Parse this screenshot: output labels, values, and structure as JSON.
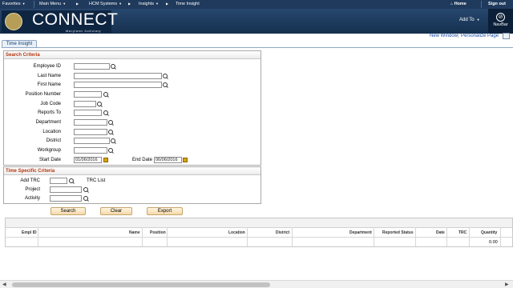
{
  "topbar": {
    "favorites": "Favorites",
    "main_menu": "Main Menu",
    "breadcrumb": [
      "HCM Systems",
      "Insights",
      "Time Insight"
    ],
    "home": "Home",
    "sign_out": "Sign out"
  },
  "header": {
    "brand": "CONNECT",
    "brand_sub": "Maryland Judiciary",
    "add_to": "Add To",
    "navbar": "NavBar"
  },
  "links": {
    "new_window": "New Window",
    "personalize": "Personalize Page"
  },
  "tab": "Time Insight",
  "search": {
    "title": "Search Criteria",
    "fields": {
      "employee_id": "Employee ID",
      "last_name": "Last Name",
      "first_name": "First Name",
      "position_number": "Position Number",
      "job_code": "Job Code",
      "reports_to": "Reports To",
      "department": "Department",
      "location": "Location",
      "district": "District",
      "workgroup": "Workgroup",
      "start_date": "Start Date",
      "end_date": "End Date"
    },
    "values": {
      "start_date": "01/06/2016",
      "end_date": "06/06/2016"
    }
  },
  "time_specific": {
    "title": "Time Specific Criteria",
    "add_trc": "Add TRC",
    "trc_list": "TRC List",
    "project": "Project",
    "activity": "Activity"
  },
  "buttons": {
    "search": "Search",
    "clear": "Clear",
    "export": "Export"
  },
  "grid": {
    "columns": [
      "Empl ID",
      "Name",
      "Position",
      "Location",
      "District",
      "Department",
      "Reported Status",
      "Date",
      "TRC",
      "Quantity"
    ],
    "quantity_value": "0.00"
  }
}
